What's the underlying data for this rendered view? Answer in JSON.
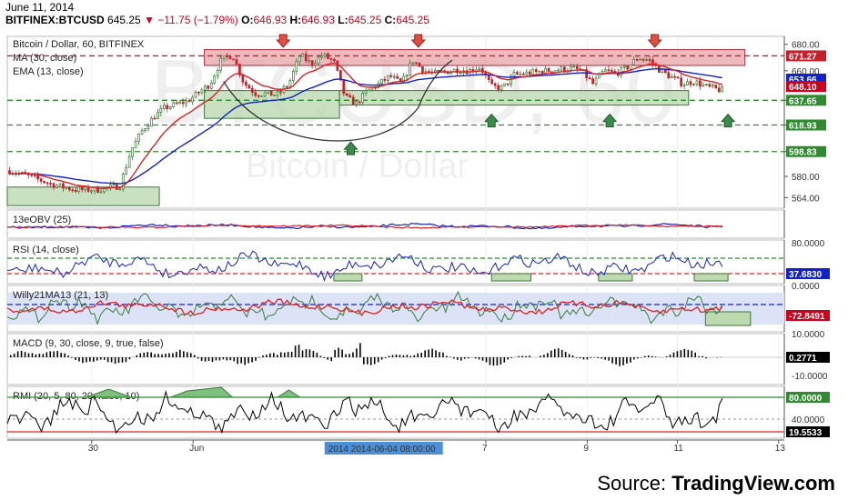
{
  "header": {
    "date": "June 11, 2014",
    "symbol": "BITFINEX:BTCUSD",
    "last": "645.25",
    "change": "▼ −11.75 (−1.79%)",
    "o_label": "O:",
    "o_value": "646.93",
    "h_label": "H:",
    "h_value": "646.93",
    "l_label": "L:",
    "l_value": "645.25",
    "c_label": "C:",
    "c_value": "645.25"
  },
  "source": {
    "prefix": "Source:",
    "brand": "TradingView.com"
  },
  "colors": {
    "up": "#2f7d2f",
    "down": "#c8202b",
    "blue": "#1122cc",
    "red": "#e02020",
    "green": "#2e8b2e",
    "axis": "#555555"
  },
  "chart_data": [
    {
      "type": "candlestick",
      "panel": "price",
      "title": "Bitcoin / Dollar, 60, BITFINEX",
      "watermark": "BTCUSD, 60",
      "watermark_sub": "Bitcoin / Dollar",
      "ylim": [
        556,
        686
      ],
      "yticks": [
        "680.00",
        "660.00",
        "637.65",
        "618.93",
        "598.83",
        "580.00",
        "564.00"
      ],
      "series": [
        {
          "name": "MA (30, close)"
        },
        {
          "name": "EMA (13, close)"
        }
      ],
      "price_points": [
        [
          0,
          585
        ],
        [
          2,
          580
        ],
        [
          4,
          574
        ],
        [
          6,
          570
        ],
        [
          8,
          570
        ],
        [
          10,
          573
        ],
        [
          11,
          600
        ],
        [
          12,
          615
        ],
        [
          13,
          625
        ],
        [
          14,
          632
        ],
        [
          16,
          637
        ],
        [
          18,
          650
        ],
        [
          19,
          668
        ],
        [
          20,
          672
        ],
        [
          21,
          651
        ],
        [
          22,
          643
        ],
        [
          24,
          642
        ],
        [
          25,
          650
        ],
        [
          26,
          672
        ],
        [
          27,
          665
        ],
        [
          28,
          672
        ],
        [
          29,
          667
        ],
        [
          30,
          640
        ],
        [
          31,
          635
        ],
        [
          32,
          645
        ],
        [
          33,
          650
        ],
        [
          34,
          656
        ],
        [
          35,
          650
        ],
        [
          36,
          668
        ],
        [
          37,
          660
        ],
        [
          38,
          658
        ],
        [
          40,
          661
        ],
        [
          41,
          660
        ],
        [
          42,
          663
        ],
        [
          43,
          648
        ],
        [
          44,
          647
        ],
        [
          45,
          657
        ],
        [
          46,
          658
        ],
        [
          48,
          660
        ],
        [
          50,
          662
        ],
        [
          51,
          660
        ],
        [
          52,
          650
        ],
        [
          53,
          660
        ],
        [
          54,
          658
        ],
        [
          55,
          662
        ],
        [
          56,
          670
        ],
        [
          57,
          668
        ],
        [
          58,
          660
        ],
        [
          59,
          655
        ],
        [
          60,
          650
        ],
        [
          61,
          652
        ],
        [
          62,
          648
        ],
        [
          63,
          646
        ],
        [
          63.5,
          645.25
        ]
      ],
      "levels": [
        {
          "value": 671.27,
          "label": "671.27",
          "color": "#c8202b"
        },
        {
          "value": 637.65,
          "label": "637.65",
          "color": "#2e8b2e"
        },
        {
          "value": 618.93,
          "label": "618.93",
          "color": "#2e8b2e"
        },
        {
          "value": 598.83,
          "label": "598.83",
          "color": "#2e8b2e"
        }
      ],
      "price_tags": [
        {
          "value": 653.66,
          "label": "653.66",
          "color": "#1122cc"
        },
        {
          "value": 648.1,
          "label": "648.10",
          "color": "#d0001c"
        }
      ],
      "zones": [
        {
          "x0": 17.5,
          "x1": 65.5,
          "y0": 664,
          "y1": 676,
          "kind": "resistance"
        },
        {
          "x0": 17.5,
          "x1": 29.5,
          "y0": 624,
          "y1": 645,
          "kind": "support"
        },
        {
          "x0": 29.5,
          "x1": 60.5,
          "y0": 634,
          "y1": 645,
          "kind": "support"
        },
        {
          "x0": 0,
          "x1": 13.5,
          "y0": 558,
          "y1": 572,
          "kind": "support"
        }
      ],
      "arrows_down": [
        24.5,
        36.5,
        57.5
      ],
      "arrows_up": [
        30.5,
        43,
        53.5,
        64
      ]
    },
    {
      "type": "line",
      "panel": "obv",
      "title": "13eOBV (25)"
    },
    {
      "type": "line",
      "panel": "rsi",
      "title": "RSI (14, close)",
      "yticks": [
        "80.0000",
        "37.6830"
      ]
    },
    {
      "type": "line",
      "panel": "willy",
      "title": "Willy21MA13 (21, 13)",
      "yticks": [
        "0.0000",
        "-72.8491"
      ]
    },
    {
      "type": "bar",
      "panel": "macd",
      "title": "MACD (9, 30, close, 9, true, false)",
      "yticks": [
        "10.0000",
        "0.2771",
        "-10.0000"
      ]
    },
    {
      "type": "line",
      "panel": "rmi",
      "title": "RMI (20, 5, 80, 20, false, 10)",
      "yticks": [
        "80.0000",
        "40.0000",
        "19.5533"
      ]
    },
    {
      "type": "time_axis",
      "xlim": [
        0,
        69
      ],
      "ticks": [
        {
          "x": 7.5,
          "label": "30"
        },
        {
          "x": 16.5,
          "label": "Jun"
        },
        {
          "x": 42.5,
          "label": "7"
        },
        {
          "x": 51.5,
          "label": "9"
        },
        {
          "x": 59.5,
          "label": "11"
        },
        {
          "x": 68.5,
          "label": "13"
        }
      ],
      "cursor": {
        "x": 28.5,
        "label": "2014  2014-06-04 08:00:00"
      }
    }
  ]
}
